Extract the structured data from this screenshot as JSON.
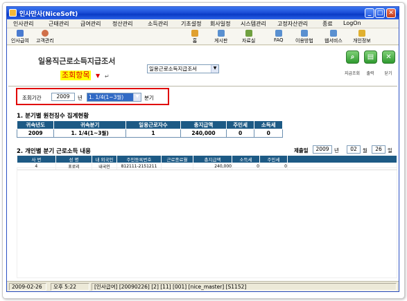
{
  "window": {
    "title": "인사만사(NiceSoft)",
    "min": "_",
    "max": "□",
    "close": "✕"
  },
  "menu": [
    "인사관리",
    "근태관리",
    "급여관리",
    "정산관리",
    "소득관리",
    "기초설정",
    "회사일정",
    "시스템관리",
    "고정자산관리",
    "종료",
    "LogOn"
  ],
  "toolbar_left": [
    {
      "label": "인사급여",
      "icon": "payroll-icon",
      "color": "#4a7bd0"
    },
    {
      "label": "고객관리",
      "icon": "customer-icon",
      "color": "#d0704a"
    }
  ],
  "toolbar_right": [
    {
      "label": "홈",
      "icon": "home-icon",
      "color": "#e0a030"
    },
    {
      "label": "게시판",
      "icon": "board-icon",
      "color": "#5a90d0"
    },
    {
      "label": "자료실",
      "icon": "archive-icon",
      "color": "#70a040"
    },
    {
      "label": "FAQ",
      "icon": "faq-icon",
      "color": "#5a90d0"
    },
    {
      "label": "이용방법",
      "icon": "guide-icon",
      "color": "#5a90d0"
    },
    {
      "label": "웹서비스",
      "icon": "webservice-icon",
      "color": "#5a90d0"
    },
    {
      "label": "개인정보",
      "icon": "privacy-icon",
      "color": "#e0b030"
    }
  ],
  "page": {
    "title": "일용직근로소득지급조서",
    "form_select": "일용근로소득지급조서",
    "annotation": "조회항목",
    "annotation_arrow": "▼",
    "annotation_return": "↵"
  },
  "actions": [
    {
      "label": "지급조회",
      "icon": "search-icon",
      "glyph": "⌕"
    },
    {
      "label": "출력",
      "icon": "print-icon",
      "glyph": "▤"
    },
    {
      "label": "닫기",
      "icon": "close-icon",
      "glyph": "✕"
    }
  ],
  "query": {
    "period_label": "조회기간",
    "year": "2009",
    "year_unit": "년",
    "quarter": "1. 1/4(1~3월)",
    "quarter_unit": "분기"
  },
  "section1": {
    "title": "1. 분기별 원천징수 집계현황",
    "headers": [
      "귀속년도",
      "귀속분기",
      "일용근로자수",
      "총지급액",
      "주민세",
      "소득세"
    ],
    "row": [
      "2009",
      "1. 1/4(1~3월)",
      "1",
      "240,000",
      "0",
      "0"
    ]
  },
  "section2": {
    "title": "2. 개인별 분기 근로소득 내용",
    "submit_label": "제출일",
    "submit_year": "2009",
    "year_unit": "년",
    "submit_month": "02",
    "month_unit": "월",
    "submit_day": "26",
    "day_unit": "일",
    "headers": [
      "사 번",
      "성 명",
      "내 외국인",
      "주민등록번호",
      "근로종료월",
      "총지급액",
      "소득세",
      "주민세"
    ],
    "rows": [
      [
        "4",
        "포로리",
        "내국인",
        "812111-2151211",
        "",
        "240,000",
        "0",
        "0"
      ]
    ]
  },
  "status": [
    "2009-02-26",
    "오후 5:22",
    "[인사급여] [20090226] [2] [11] [001] [nice_master] [S1152]"
  ]
}
